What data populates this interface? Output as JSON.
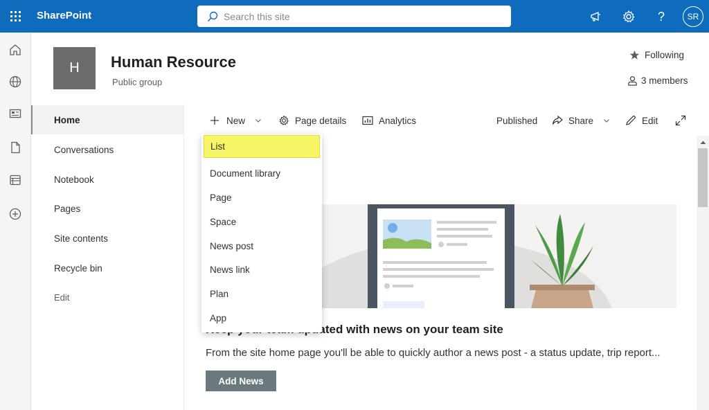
{
  "suite": {
    "app_name": "SharePoint",
    "search_placeholder": "Search this site",
    "avatar_initials": "SR",
    "brand_color": "#0f6cbd"
  },
  "site": {
    "logo_letter": "H",
    "title": "Human Resource",
    "subtitle": "Public group",
    "following_label": "Following",
    "members_label": "3 members"
  },
  "leftnav": {
    "items": [
      {
        "label": "Home",
        "active": true
      },
      {
        "label": "Conversations"
      },
      {
        "label": "Notebook"
      },
      {
        "label": "Pages"
      },
      {
        "label": "Site contents"
      },
      {
        "label": "Recycle bin"
      }
    ],
    "edit_label": "Edit"
  },
  "commandbar": {
    "new_label": "New",
    "page_details_label": "Page details",
    "analytics_label": "Analytics",
    "published_label": "Published",
    "share_label": "Share",
    "edit_label": "Edit"
  },
  "new_menu": {
    "items": [
      "List",
      "Document library",
      "Page",
      "Space",
      "News post",
      "News link",
      "Plan",
      "App"
    ],
    "highlighted": "List",
    "highlight_color": "#f5f565"
  },
  "news": {
    "heading": "Keep your team updated with news on your team site",
    "description": "From the site home page you'll be able to quickly author a news post - a status update, trip report...",
    "add_button": "Add News"
  }
}
